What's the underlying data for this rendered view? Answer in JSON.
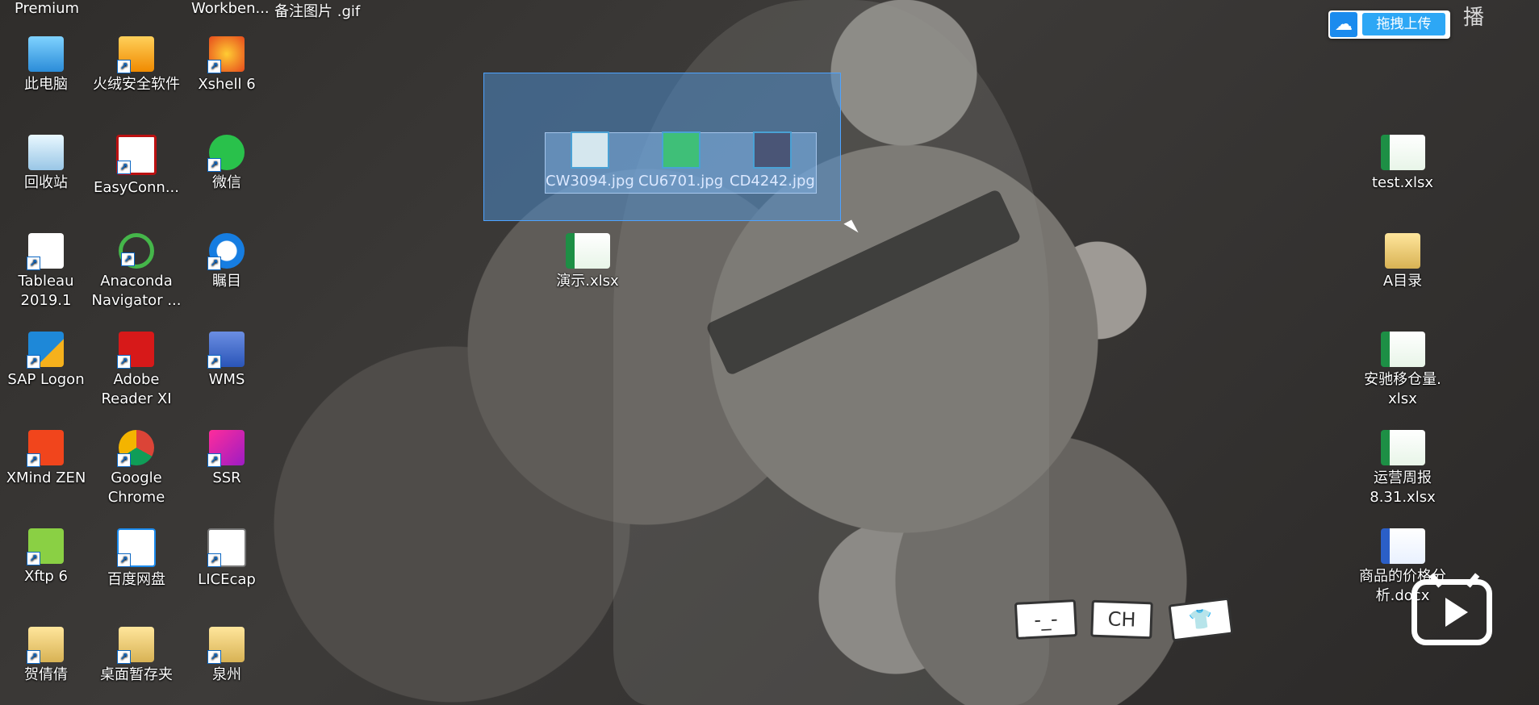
{
  "top_texts": [
    "Premium",
    "Workben...",
    "备注图片 .gif"
  ],
  "icons_left": [
    {
      "label": "此电脑",
      "icon": "computer-icon"
    },
    {
      "label": "火绒安全软件",
      "icon": "fire-shield-icon"
    },
    {
      "label": "Xshell 6",
      "icon": "xshell-icon"
    },
    {
      "label": "回收站",
      "icon": "recycle-bin-icon"
    },
    {
      "label": "EasyConn...",
      "icon": "easyconnect-icon"
    },
    {
      "label": "微信",
      "icon": "wechat-icon"
    },
    {
      "label": "Tableau\n2019.1",
      "icon": "tableau-icon"
    },
    {
      "label": "Anaconda\nNavigator ...",
      "icon": "anaconda-icon"
    },
    {
      "label": "瞩目",
      "icon": "zhumu-icon"
    },
    {
      "label": "SAP Logon",
      "icon": "sap-icon"
    },
    {
      "label": "Adobe\nReader XI",
      "icon": "adobe-reader-icon"
    },
    {
      "label": "WMS",
      "icon": "wms-icon"
    },
    {
      "label": "XMind ZEN",
      "icon": "xmind-icon"
    },
    {
      "label": "Google\nChrome",
      "icon": "chrome-icon"
    },
    {
      "label": "SSR",
      "icon": "ssr-icon"
    },
    {
      "label": "Xftp 6",
      "icon": "xftp-icon"
    },
    {
      "label": "百度网盘",
      "icon": "baidu-netdisk-icon"
    },
    {
      "label": "LICEcap",
      "icon": "licecap-icon"
    },
    {
      "label": "贺倩倩",
      "icon": "folder-icon"
    },
    {
      "label": "桌面暂存夹",
      "icon": "folder-icon"
    },
    {
      "label": "泉州",
      "icon": "folder-icon"
    }
  ],
  "dragged_files": [
    "CW3094.jpg",
    "CU6701.jpg",
    "CD4242.jpg"
  ],
  "center_file": "演示.xlsx",
  "right_icons": [
    {
      "label": "test.xlsx",
      "icon": "excel-file-icon"
    },
    {
      "label": "A目录",
      "icon": "folder-icon"
    },
    {
      "label": "安驰移仓量.\nxlsx",
      "icon": "excel-file-icon"
    },
    {
      "label": "运营周报\n8.31.xlsx",
      "icon": "excel-file-icon"
    },
    {
      "label": "商品的价格分\n析.docx",
      "icon": "word-file-icon"
    }
  ],
  "upload_widget": {
    "label": "拖拽上传",
    "side_text": "播"
  },
  "stickers": [
    "-_-",
    "CH",
    "👕"
  ]
}
